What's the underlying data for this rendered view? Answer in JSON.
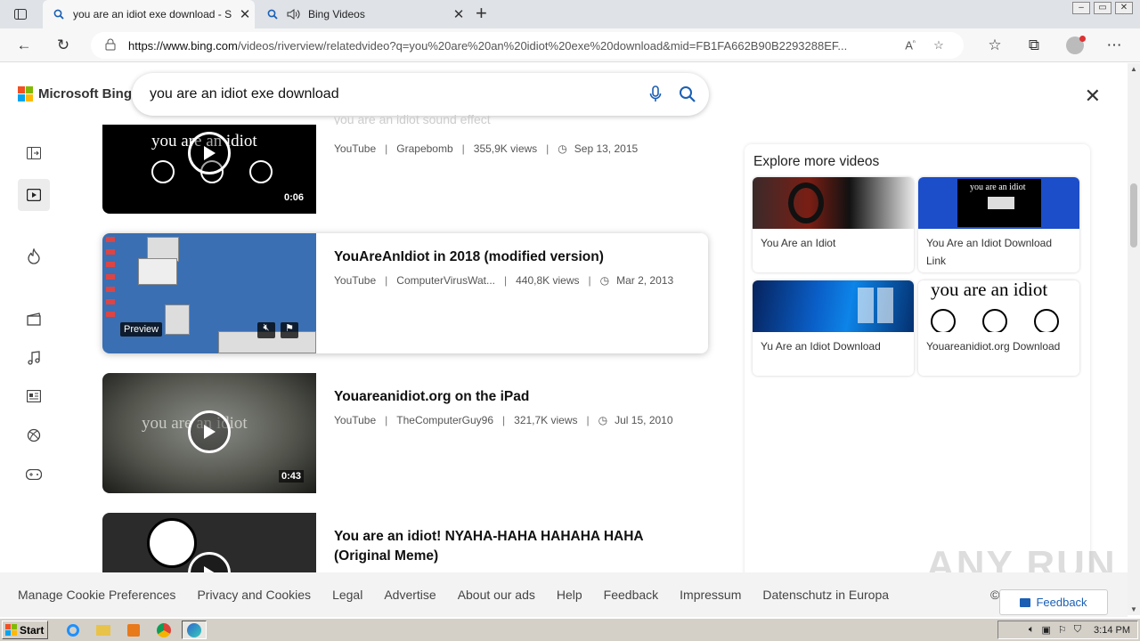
{
  "browser": {
    "tabs": [
      {
        "label": "you are an idiot exe download - S",
        "icon": "search-icon"
      },
      {
        "label": "Bing Videos",
        "icon": "search-icon"
      }
    ],
    "url_host": "https://www.bing.com",
    "url_path": "/videos/riverview/relatedvideo?q=you%20are%20an%20idiot%20exe%20download&mid=FB1FA662B90B2293288EF..."
  },
  "bing": {
    "brand": "Microsoft Bing",
    "query": "you are an idiot exe download"
  },
  "videos": {
    "partial_title": "you are an idiot sound effect",
    "items": [
      {
        "title": "",
        "source": "YouTube",
        "channel": "Grapebomb",
        "views": "355,9K views",
        "date": "Sep 13, 2015",
        "duration": "0:06",
        "thumb_text": "you are an idiot"
      },
      {
        "title": "YouAreAnIdiot in 2018 (modified version)",
        "source": "YouTube",
        "channel": "ComputerVirusWat...",
        "views": "440,8K views",
        "date": "Mar 2, 2013",
        "preview_label": "Preview"
      },
      {
        "title": "Youareanidiot.org on the iPad",
        "source": "YouTube",
        "channel": "TheComputerGuy96",
        "views": "321,7K views",
        "date": "Jul 15, 2010",
        "duration": "0:43",
        "thumb_text": "you are an idiot"
      },
      {
        "title": "You are an idiot! NYAHA-HAHA HAHAHA HAHA (Original Meme)",
        "source": "",
        "channel": "",
        "views": "",
        "date": ""
      }
    ]
  },
  "explore": {
    "heading": "Explore more videos",
    "cards": [
      {
        "label": "You Are an Idiot"
      },
      {
        "label": "You Are an Idiot Download Link",
        "thumb_text": "you are an idiot"
      },
      {
        "label": "Yu Are an Idiot Download"
      },
      {
        "label": "Youareanidiot.org Download",
        "thumb_text": "you are an idiot"
      }
    ]
  },
  "footer": {
    "links": [
      "Manage Cookie Preferences",
      "Privacy and Cookies",
      "Legal",
      "Advertise",
      "About our ads",
      "Help",
      "Feedback",
      "Impressum",
      "Datenschutz in Europa"
    ],
    "feedback_button": "Feedback",
    "copyright_partial": "©"
  },
  "taskbar": {
    "start_label": "Start",
    "clock": "3:14 PM"
  },
  "watermark": "ANY RUN",
  "colors": {
    "bing_blue": "#1a5fb4",
    "ms_red": "#f25022",
    "ms_green": "#7fba00",
    "ms_blue": "#00a4ef",
    "ms_yellow": "#ffb900"
  }
}
